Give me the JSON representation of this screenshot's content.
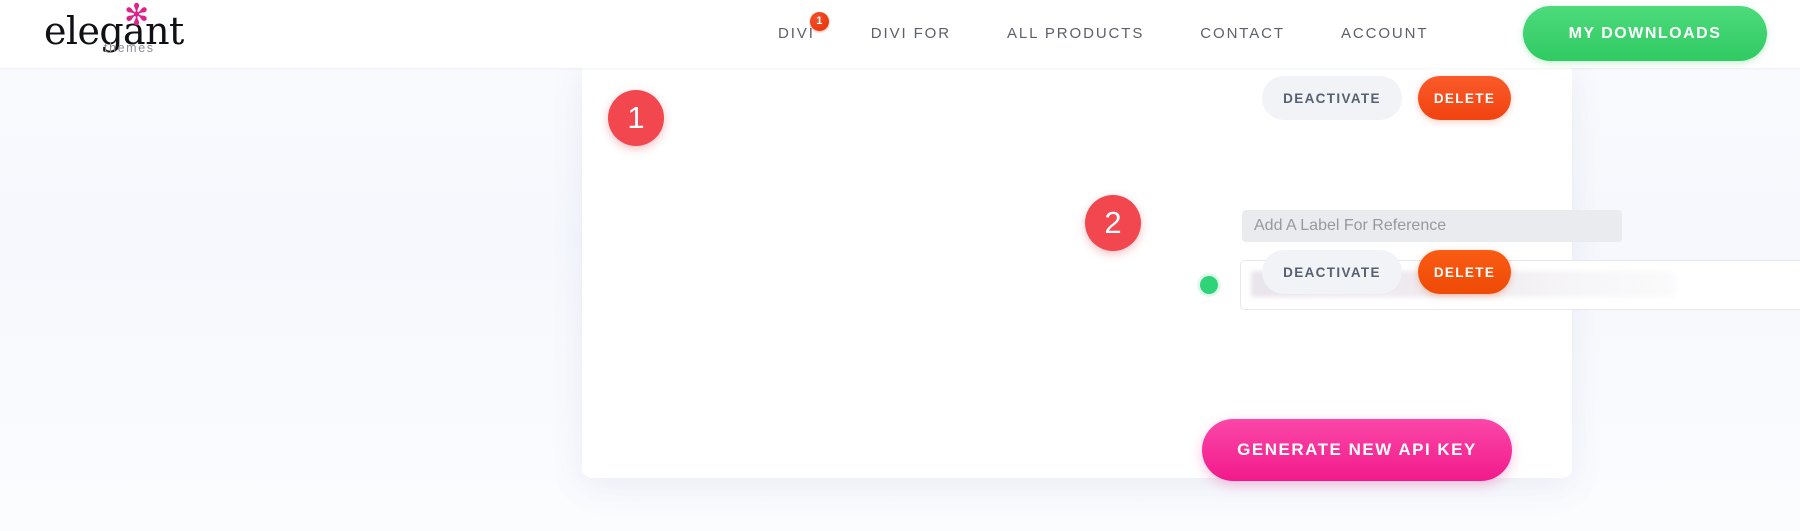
{
  "header": {
    "brand": {
      "wordmark": "elegant",
      "asterisk": "✻",
      "sub": "themes"
    },
    "nav_items": [
      {
        "label": "DIVI",
        "badge": "1"
      },
      {
        "label": "DIVI FOR",
        "badge": null
      },
      {
        "label": "ALL PRODUCTS",
        "badge": null
      },
      {
        "label": "CONTACT",
        "badge": null
      },
      {
        "label": "ACCOUNT",
        "badge": null
      }
    ],
    "downloads_button": "MY DOWNLOADS"
  },
  "card": {
    "action_row_top": {
      "deactivate_label": "DEACTIVATE",
      "delete_label": "DELETE"
    },
    "label_input": {
      "placeholder": "Add A Label For Reference",
      "value": ""
    },
    "api_key_row": {
      "status": "active",
      "key_value": ""
    },
    "action_row_second": {
      "deactivate_label": "DEACTIVATE",
      "delete_label": "DELETE"
    },
    "generate_button": "GENERATE NEW API KEY"
  },
  "annotations": [
    {
      "number": "1"
    },
    {
      "number": "2"
    }
  ],
  "colors": {
    "brand_pink": "#e0218a",
    "downloads_green": "#30ca62",
    "delete_orange": "#f1430f",
    "generate_pink": "#f21a8b",
    "status_green": "#2ed477",
    "annotation_red": "#f2474f",
    "badge_red": "#e8380d"
  }
}
